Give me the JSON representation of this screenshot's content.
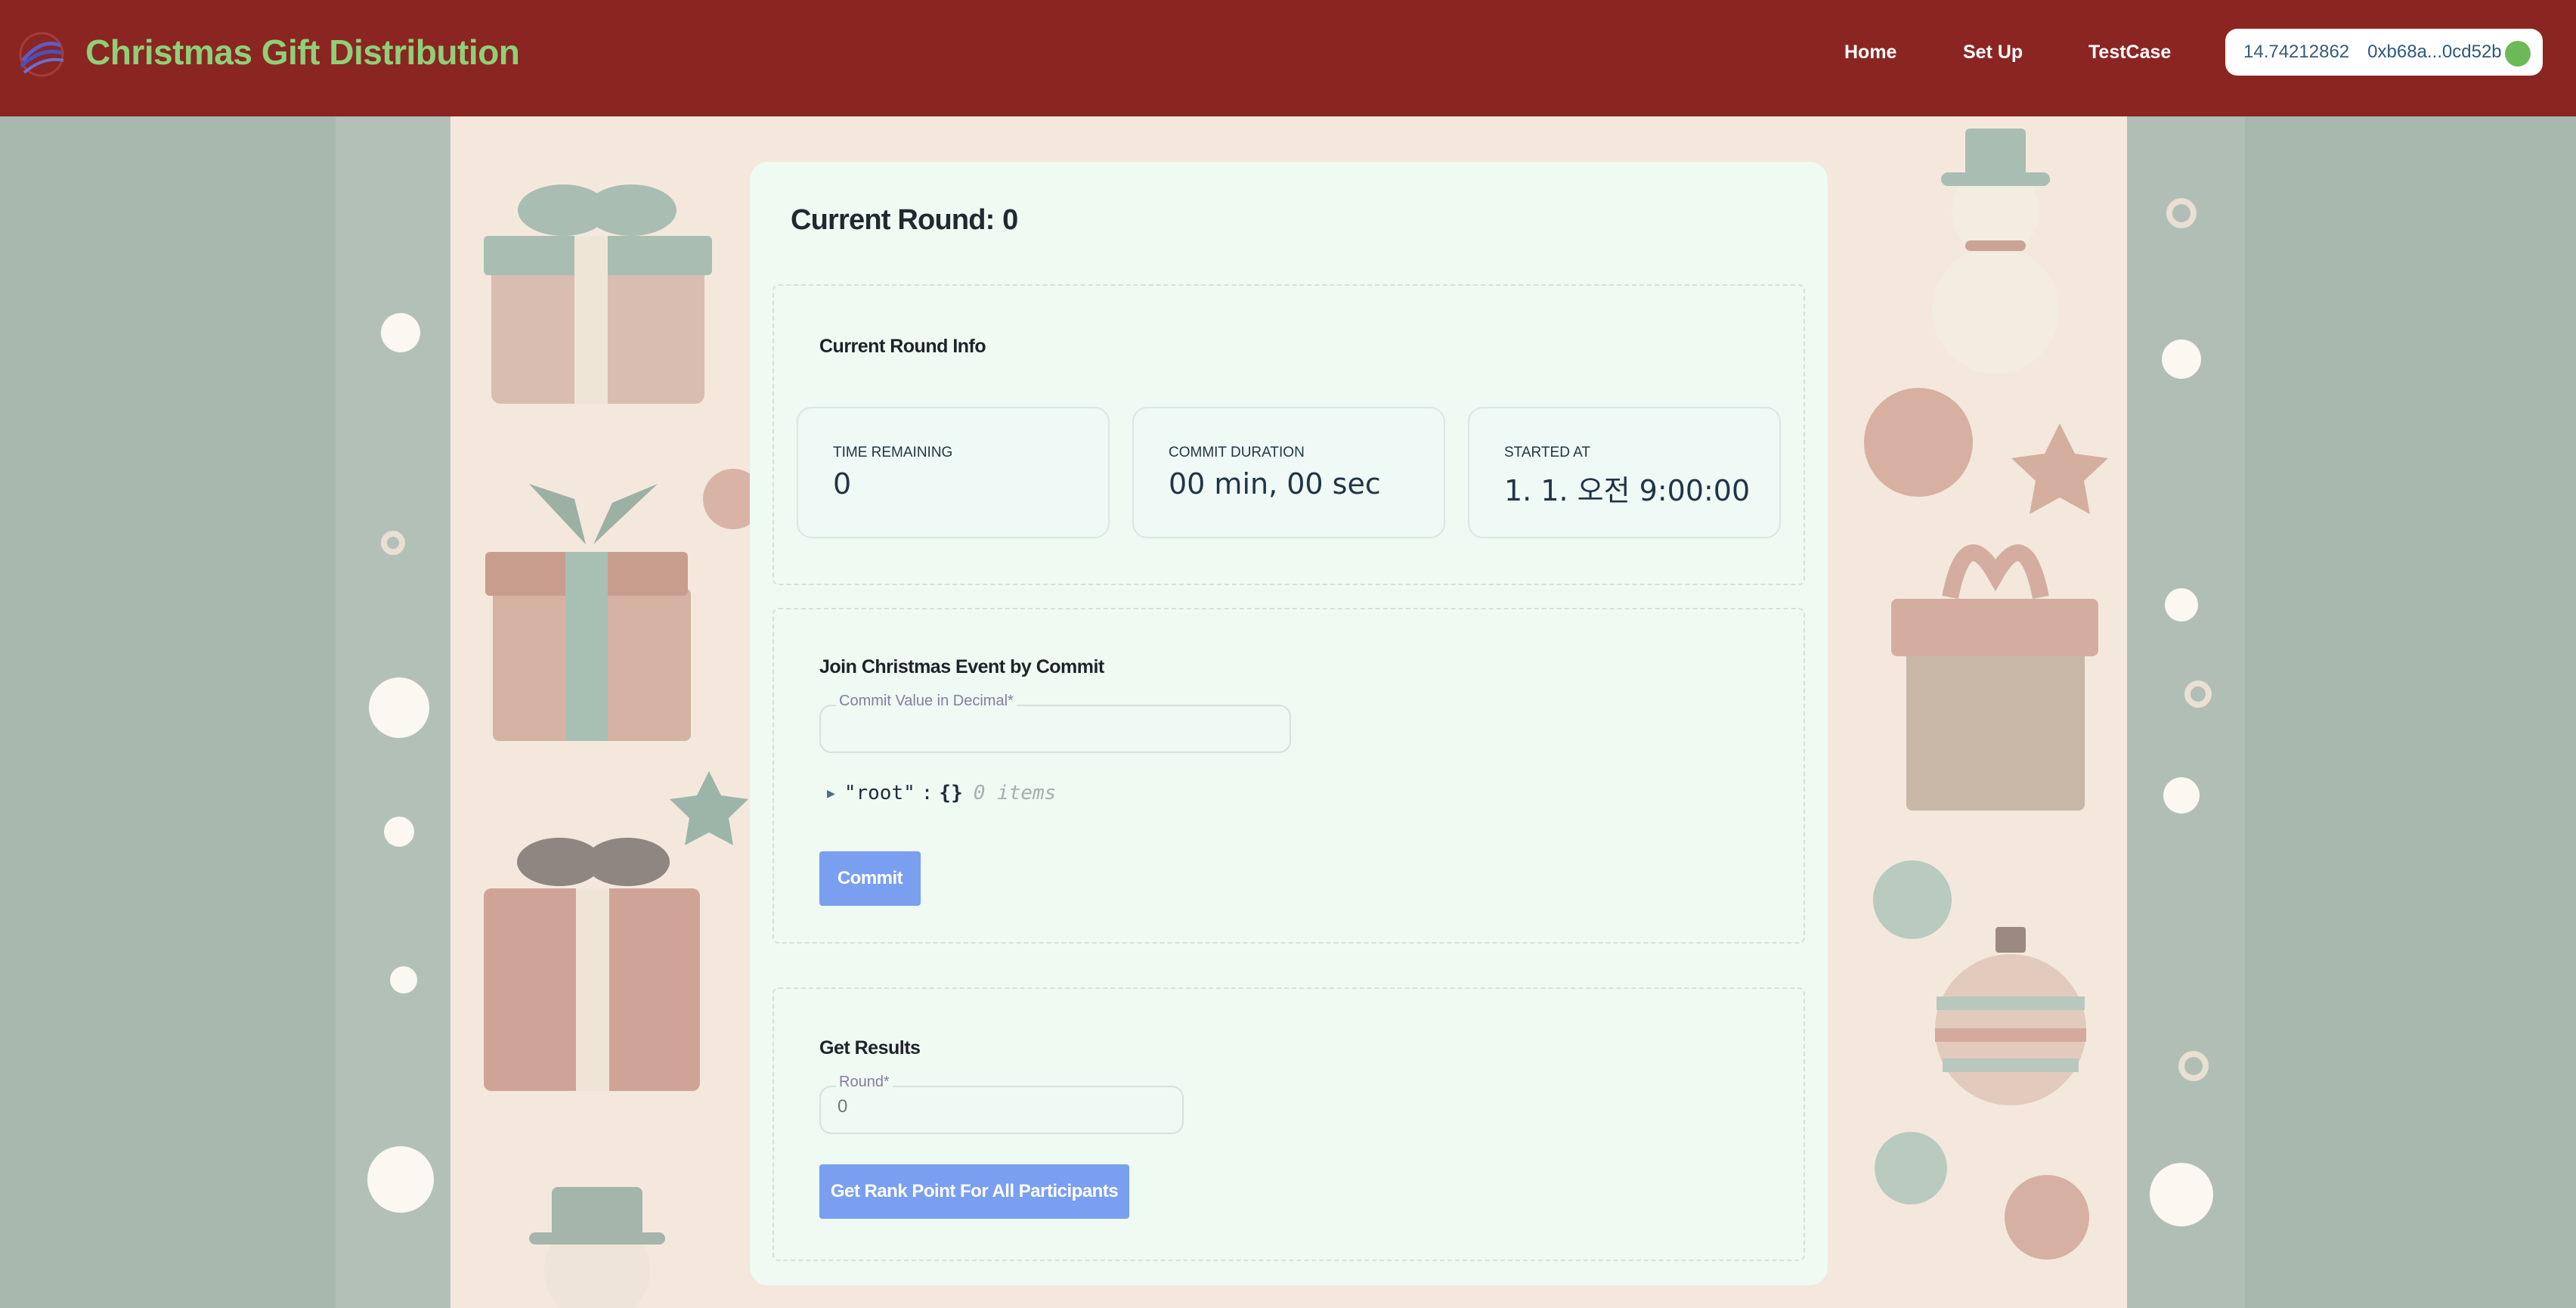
{
  "header": {
    "title": "Christmas Gift Distribution",
    "nav": [
      "Home",
      "Set Up",
      "TestCase"
    ],
    "wallet": {
      "balance": "14.74212862",
      "address": "0xb68a...0cd52b"
    },
    "colors": {
      "bar": "#8b2521",
      "title": "#8ed079"
    }
  },
  "main": {
    "round_label": "Current Round:",
    "round_value": "0",
    "round_info": {
      "title": "Current Round Info",
      "stats": [
        {
          "label": "TIME REMAINING",
          "value": "0"
        },
        {
          "label": "COMMIT DURATION",
          "value": "00 min, 00 sec"
        },
        {
          "label": "STARTED AT",
          "value": "1. 1. 오전 9:00:00"
        }
      ]
    },
    "commit": {
      "title": "Join Christmas Event by Commit",
      "field_label": "Commit Value in Decimal*",
      "field_value": "",
      "json_key": "\"root\"",
      "json_sep": ":",
      "json_braces": "{}",
      "json_items": "0 items",
      "button": "Commit"
    },
    "results": {
      "title": "Get Results",
      "field_label": "Round*",
      "field_placeholder": "0",
      "button": "Get Rank Point For All Participants"
    }
  }
}
